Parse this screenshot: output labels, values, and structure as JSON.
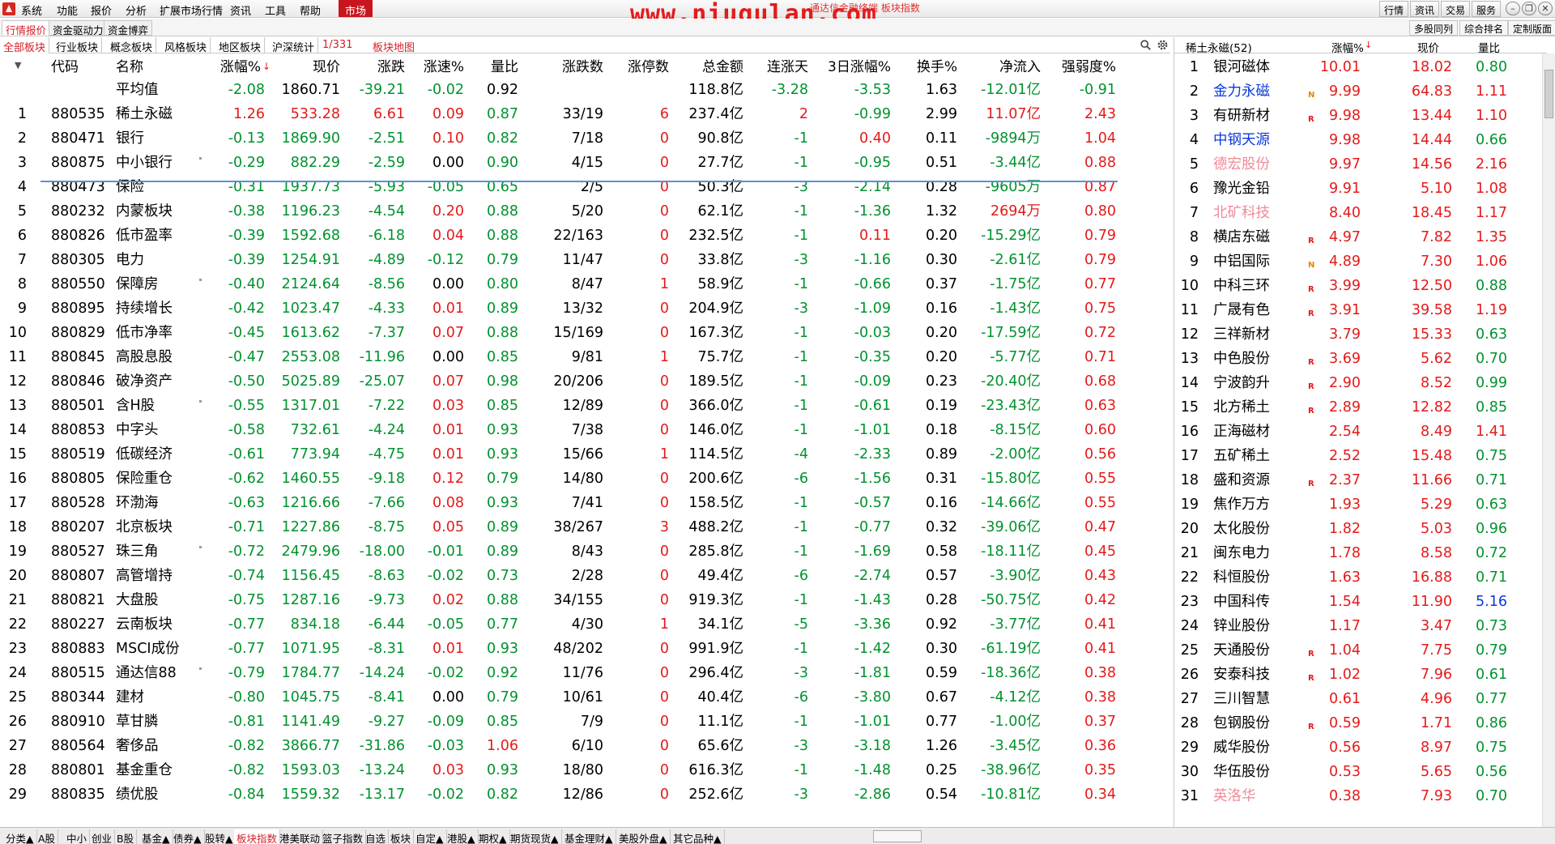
{
  "menu": [
    "系统",
    "功能",
    "报价",
    "分析",
    "扩展市场行情",
    "资讯",
    "工具",
    "帮助"
  ],
  "menu_active": "市场",
  "window_title": "通达信金融终端 板块指数",
  "watermark": "www.niugulan.com",
  "top_buttons": [
    "行情",
    "资讯",
    "交易",
    "服务"
  ],
  "subtabs": [
    "行情报价",
    "资金驱动力",
    "资金博弈"
  ],
  "right_buttons": [
    "多股同列",
    "综合排名",
    "定制版面"
  ],
  "category_tabs": [
    "全部板块",
    "行业板块",
    "概念板块",
    "风格板块",
    "地区板块",
    "沪深统计"
  ],
  "page_counter": "1/331",
  "map_link": "板块地图",
  "columns": [
    "代码",
    "名称",
    "涨幅%",
    "现价",
    "涨跌",
    "涨速%",
    "量比",
    "涨跌数",
    "涨停数",
    "总金额",
    "连涨天",
    "3日涨幅%",
    "换手%",
    "净流入",
    "强弱度%"
  ],
  "average_row": {
    "name": "平均值",
    "chg": "-2.08",
    "price": "1860.71",
    "diff": "-39.21",
    "speed": "-0.02",
    "vr": "0.92",
    "amount": "118.8亿",
    "days": "-3.28",
    "chg3": "-3.53",
    "turnover": "1.63",
    "inflow": "-12.01亿",
    "strength": "-0.91"
  },
  "rows": [
    {
      "n": "1",
      "code": "880535",
      "name": "稀土永磁",
      "chg": "1.26",
      "price": "533.28",
      "diff": "6.61",
      "speed": "0.09",
      "vr": "0.87",
      "updown": "33/19",
      "limit": "6",
      "amount": "237.4亿",
      "days": "2",
      "chg3": "-0.99",
      "turnover": "2.99",
      "inflow": "11.07亿",
      "strength": "2.43",
      "dot": false
    },
    {
      "n": "2",
      "code": "880471",
      "name": "银行",
      "chg": "-0.13",
      "price": "1869.90",
      "diff": "-2.51",
      "speed": "0.10",
      "vr": "0.82",
      "updown": "7/18",
      "limit": "0",
      "amount": "90.8亿",
      "days": "-1",
      "chg3": "0.40",
      "turnover": "0.11",
      "inflow": "-9894万",
      "strength": "1.04",
      "dot": false
    },
    {
      "n": "3",
      "code": "880875",
      "name": "中小银行",
      "chg": "-0.29",
      "price": "882.29",
      "diff": "-2.59",
      "speed": "0.00",
      "vr": "0.90",
      "updown": "4/15",
      "limit": "0",
      "amount": "27.7亿",
      "days": "-1",
      "chg3": "-0.95",
      "turnover": "0.51",
      "inflow": "-3.44亿",
      "strength": "0.88",
      "dot": true
    },
    {
      "n": "4",
      "code": "880473",
      "name": "保险",
      "chg": "-0.31",
      "price": "1937.73",
      "diff": "-5.93",
      "speed": "-0.05",
      "vr": "0.65",
      "updown": "2/5",
      "limit": "0",
      "amount": "50.3亿",
      "days": "-3",
      "chg3": "-2.14",
      "turnover": "0.28",
      "inflow": "-9605万",
      "strength": "0.87",
      "dot": false
    },
    {
      "n": "5",
      "code": "880232",
      "name": "内蒙板块",
      "chg": "-0.38",
      "price": "1196.23",
      "diff": "-4.54",
      "speed": "0.20",
      "vr": "0.88",
      "updown": "5/20",
      "limit": "0",
      "amount": "62.1亿",
      "days": "-1",
      "chg3": "-1.36",
      "turnover": "1.32",
      "inflow": "2694万",
      "strength": "0.80",
      "dot": false
    },
    {
      "n": "6",
      "code": "880826",
      "name": "低市盈率",
      "chg": "-0.39",
      "price": "1592.68",
      "diff": "-6.18",
      "speed": "0.04",
      "vr": "0.88",
      "updown": "22/163",
      "limit": "0",
      "amount": "232.5亿",
      "days": "-1",
      "chg3": "0.11",
      "turnover": "0.20",
      "inflow": "-15.29亿",
      "strength": "0.79",
      "dot": false
    },
    {
      "n": "7",
      "code": "880305",
      "name": "电力",
      "chg": "-0.39",
      "price": "1254.91",
      "diff": "-4.89",
      "speed": "-0.12",
      "vr": "0.79",
      "updown": "11/47",
      "limit": "0",
      "amount": "33.8亿",
      "days": "-3",
      "chg3": "-1.16",
      "turnover": "0.30",
      "inflow": "-2.61亿",
      "strength": "0.79",
      "dot": false
    },
    {
      "n": "8",
      "code": "880550",
      "name": "保障房",
      "chg": "-0.40",
      "price": "2124.64",
      "diff": "-8.56",
      "speed": "0.00",
      "vr": "0.80",
      "updown": "8/47",
      "limit": "1",
      "amount": "58.9亿",
      "days": "-1",
      "chg3": "-0.66",
      "turnover": "0.37",
      "inflow": "-1.75亿",
      "strength": "0.77",
      "dot": true
    },
    {
      "n": "9",
      "code": "880895",
      "name": "持续增长",
      "chg": "-0.42",
      "price": "1023.47",
      "diff": "-4.33",
      "speed": "0.01",
      "vr": "0.89",
      "updown": "13/32",
      "limit": "0",
      "amount": "204.9亿",
      "days": "-3",
      "chg3": "-1.09",
      "turnover": "0.16",
      "inflow": "-1.43亿",
      "strength": "0.75",
      "dot": false
    },
    {
      "n": "10",
      "code": "880829",
      "name": "低市净率",
      "chg": "-0.45",
      "price": "1613.62",
      "diff": "-7.37",
      "speed": "0.07",
      "vr": "0.88",
      "updown": "15/169",
      "limit": "0",
      "amount": "167.3亿",
      "days": "-1",
      "chg3": "-0.03",
      "turnover": "0.20",
      "inflow": "-17.59亿",
      "strength": "0.72",
      "dot": false
    },
    {
      "n": "11",
      "code": "880845",
      "name": "高股息股",
      "chg": "-0.47",
      "price": "2553.08",
      "diff": "-11.96",
      "speed": "0.00",
      "vr": "0.85",
      "updown": "9/81",
      "limit": "1",
      "amount": "75.7亿",
      "days": "-1",
      "chg3": "-0.35",
      "turnover": "0.20",
      "inflow": "-5.77亿",
      "strength": "0.71",
      "dot": false
    },
    {
      "n": "12",
      "code": "880846",
      "name": "破净资产",
      "chg": "-0.50",
      "price": "5025.89",
      "diff": "-25.07",
      "speed": "0.07",
      "vr": "0.98",
      "updown": "20/206",
      "limit": "0",
      "amount": "189.5亿",
      "days": "-1",
      "chg3": "-0.09",
      "turnover": "0.23",
      "inflow": "-20.40亿",
      "strength": "0.68",
      "dot": false
    },
    {
      "n": "13",
      "code": "880501",
      "name": "含H股",
      "chg": "-0.55",
      "price": "1317.01",
      "diff": "-7.22",
      "speed": "0.03",
      "vr": "0.85",
      "updown": "12/89",
      "limit": "0",
      "amount": "366.0亿",
      "days": "-1",
      "chg3": "-0.61",
      "turnover": "0.19",
      "inflow": "-23.43亿",
      "strength": "0.63",
      "dot": true
    },
    {
      "n": "14",
      "code": "880853",
      "name": "中字头",
      "chg": "-0.58",
      "price": "732.61",
      "diff": "-4.24",
      "speed": "0.01",
      "vr": "0.93",
      "updown": "7/38",
      "limit": "0",
      "amount": "146.0亿",
      "days": "-1",
      "chg3": "-1.01",
      "turnover": "0.18",
      "inflow": "-8.15亿",
      "strength": "0.60",
      "dot": false
    },
    {
      "n": "15",
      "code": "880519",
      "name": "低碳经济",
      "chg": "-0.61",
      "price": "773.94",
      "diff": "-4.75",
      "speed": "0.01",
      "vr": "0.93",
      "updown": "15/66",
      "limit": "1",
      "amount": "114.5亿",
      "days": "-4",
      "chg3": "-2.33",
      "turnover": "0.89",
      "inflow": "-2.00亿",
      "strength": "0.56",
      "dot": false
    },
    {
      "n": "16",
      "code": "880805",
      "name": "保险重仓",
      "chg": "-0.62",
      "price": "1460.55",
      "diff": "-9.18",
      "speed": "0.12",
      "vr": "0.79",
      "updown": "14/80",
      "limit": "0",
      "amount": "200.6亿",
      "days": "-6",
      "chg3": "-1.56",
      "turnover": "0.31",
      "inflow": "-15.80亿",
      "strength": "0.55",
      "dot": false
    },
    {
      "n": "17",
      "code": "880528",
      "name": "环渤海",
      "chg": "-0.63",
      "price": "1216.66",
      "diff": "-7.66",
      "speed": "0.08",
      "vr": "0.93",
      "updown": "7/41",
      "limit": "0",
      "amount": "158.5亿",
      "days": "-1",
      "chg3": "-0.57",
      "turnover": "0.16",
      "inflow": "-14.66亿",
      "strength": "0.55",
      "dot": false
    },
    {
      "n": "18",
      "code": "880207",
      "name": "北京板块",
      "chg": "-0.71",
      "price": "1227.86",
      "diff": "-8.75",
      "speed": "0.05",
      "vr": "0.89",
      "updown": "38/267",
      "limit": "3",
      "amount": "488.2亿",
      "days": "-1",
      "chg3": "-0.77",
      "turnover": "0.32",
      "inflow": "-39.06亿",
      "strength": "0.47",
      "dot": false
    },
    {
      "n": "19",
      "code": "880527",
      "name": "珠三角",
      "chg": "-0.72",
      "price": "2479.96",
      "diff": "-18.00",
      "speed": "-0.01",
      "vr": "0.89",
      "updown": "8/43",
      "limit": "0",
      "amount": "285.8亿",
      "days": "-1",
      "chg3": "-1.69",
      "turnover": "0.58",
      "inflow": "-18.11亿",
      "strength": "0.45",
      "dot": true
    },
    {
      "n": "20",
      "code": "880807",
      "name": "高管增持",
      "chg": "-0.74",
      "price": "1156.45",
      "diff": "-8.63",
      "speed": "-0.02",
      "vr": "0.73",
      "updown": "2/28",
      "limit": "0",
      "amount": "49.4亿",
      "days": "-6",
      "chg3": "-2.74",
      "turnover": "0.57",
      "inflow": "-3.90亿",
      "strength": "0.43",
      "dot": false
    },
    {
      "n": "21",
      "code": "880821",
      "name": "大盘股",
      "chg": "-0.75",
      "price": "1287.16",
      "diff": "-9.73",
      "speed": "0.02",
      "vr": "0.88",
      "updown": "34/155",
      "limit": "0",
      "amount": "919.3亿",
      "days": "-1",
      "chg3": "-1.43",
      "turnover": "0.28",
      "inflow": "-50.75亿",
      "strength": "0.42",
      "dot": false
    },
    {
      "n": "22",
      "code": "880227",
      "name": "云南板块",
      "chg": "-0.77",
      "price": "834.18",
      "diff": "-6.44",
      "speed": "-0.05",
      "vr": "0.77",
      "updown": "4/30",
      "limit": "1",
      "amount": "34.1亿",
      "days": "-5",
      "chg3": "-3.36",
      "turnover": "0.92",
      "inflow": "-3.77亿",
      "strength": "0.41",
      "dot": false
    },
    {
      "n": "23",
      "code": "880883",
      "name": "MSCI成份",
      "chg": "-0.77",
      "price": "1071.95",
      "diff": "-8.31",
      "speed": "0.01",
      "vr": "0.93",
      "updown": "48/202",
      "limit": "0",
      "amount": "991.9亿",
      "days": "-1",
      "chg3": "-1.42",
      "turnover": "0.30",
      "inflow": "-61.19亿",
      "strength": "0.41",
      "dot": false
    },
    {
      "n": "24",
      "code": "880515",
      "name": "通达信88",
      "chg": "-0.79",
      "price": "1784.77",
      "diff": "-14.24",
      "speed": "-0.02",
      "vr": "0.92",
      "updown": "11/76",
      "limit": "0",
      "amount": "296.4亿",
      "days": "-3",
      "chg3": "-1.81",
      "turnover": "0.59",
      "inflow": "-18.36亿",
      "strength": "0.38",
      "dot": true
    },
    {
      "n": "25",
      "code": "880344",
      "name": "建材",
      "chg": "-0.80",
      "price": "1045.75",
      "diff": "-8.41",
      "speed": "0.00",
      "vr": "0.79",
      "updown": "10/61",
      "limit": "0",
      "amount": "40.4亿",
      "days": "-6",
      "chg3": "-3.80",
      "turnover": "0.67",
      "inflow": "-4.12亿",
      "strength": "0.38",
      "dot": false
    },
    {
      "n": "26",
      "code": "880910",
      "name": "草甘膦",
      "chg": "-0.81",
      "price": "1141.49",
      "diff": "-9.27",
      "speed": "-0.09",
      "vr": "0.85",
      "updown": "7/9",
      "limit": "0",
      "amount": "11.1亿",
      "days": "-1",
      "chg3": "-1.01",
      "turnover": "0.77",
      "inflow": "-1.00亿",
      "strength": "0.37",
      "dot": false
    },
    {
      "n": "27",
      "code": "880564",
      "name": "奢侈品",
      "chg": "-0.82",
      "price": "3866.77",
      "diff": "-31.86",
      "speed": "-0.03",
      "vr": "1.06",
      "updown": "6/10",
      "limit": "0",
      "amount": "65.6亿",
      "days": "-3",
      "chg3": "-3.18",
      "turnover": "1.26",
      "inflow": "-3.45亿",
      "strength": "0.36",
      "dot": false
    },
    {
      "n": "28",
      "code": "880801",
      "name": "基金重仓",
      "chg": "-0.82",
      "price": "1593.03",
      "diff": "-13.24",
      "speed": "0.03",
      "vr": "0.93",
      "updown": "18/80",
      "limit": "0",
      "amount": "616.3亿",
      "days": "-1",
      "chg3": "-1.48",
      "turnover": "0.25",
      "inflow": "-38.96亿",
      "strength": "0.35",
      "dot": false
    },
    {
      "n": "29",
      "code": "880835",
      "name": "绩优股",
      "chg": "-0.84",
      "price": "1559.32",
      "diff": "-13.17",
      "speed": "-0.02",
      "vr": "0.82",
      "updown": "12/86",
      "limit": "0",
      "amount": "252.6亿",
      "days": "-3",
      "chg3": "-2.86",
      "turnover": "0.54",
      "inflow": "-10.81亿",
      "strength": "0.34",
      "dot": false
    }
  ],
  "right_panel": {
    "title": "稀土永磁(52)",
    "columns": [
      "涨幅%",
      "现价",
      "量比"
    ],
    "rows": [
      {
        "n": "1",
        "name": "银河磁体",
        "style": "black",
        "flag": "",
        "chg": "10.01",
        "price": "18.02",
        "vr": "0.80",
        "vr_style": "green"
      },
      {
        "n": "2",
        "name": "金力永磁",
        "style": "blue",
        "flag": "N",
        "chg": "9.99",
        "price": "64.83",
        "vr": "1.11",
        "vr_style": "red"
      },
      {
        "n": "3",
        "name": "有研新材",
        "style": "black",
        "flag": "R",
        "chg": "9.98",
        "price": "13.44",
        "vr": "1.10",
        "vr_style": "red"
      },
      {
        "n": "4",
        "name": "中钢天源",
        "style": "blue",
        "flag": "",
        "chg": "9.98",
        "price": "14.44",
        "vr": "0.66",
        "vr_style": "green"
      },
      {
        "n": "5",
        "name": "德宏股份",
        "style": "pink",
        "flag": "",
        "chg": "9.97",
        "price": "14.56",
        "vr": "2.16",
        "vr_style": "red"
      },
      {
        "n": "6",
        "name": "豫光金铅",
        "style": "black",
        "flag": "",
        "chg": "9.91",
        "price": "5.10",
        "vr": "1.08",
        "vr_style": "red"
      },
      {
        "n": "7",
        "name": "北矿科技",
        "style": "pink",
        "flag": "",
        "chg": "8.40",
        "price": "18.45",
        "vr": "1.17",
        "vr_style": "red"
      },
      {
        "n": "8",
        "name": "横店东磁",
        "style": "black",
        "flag": "R",
        "chg": "4.97",
        "price": "7.82",
        "vr": "1.35",
        "vr_style": "red"
      },
      {
        "n": "9",
        "name": "中铝国际",
        "style": "black",
        "flag": "N",
        "chg": "4.89",
        "price": "7.30",
        "vr": "1.06",
        "vr_style": "red"
      },
      {
        "n": "10",
        "name": "中科三环",
        "style": "black",
        "flag": "R",
        "chg": "3.99",
        "price": "12.50",
        "vr": "0.88",
        "vr_style": "green"
      },
      {
        "n": "11",
        "name": "广晟有色",
        "style": "black",
        "flag": "R",
        "chg": "3.91",
        "price": "39.58",
        "vr": "1.19",
        "vr_style": "red"
      },
      {
        "n": "12",
        "name": "三祥新材",
        "style": "black",
        "flag": "",
        "chg": "3.79",
        "price": "15.33",
        "vr": "0.63",
        "vr_style": "green"
      },
      {
        "n": "13",
        "name": "中色股份",
        "style": "black",
        "flag": "R",
        "chg": "3.69",
        "price": "5.62",
        "vr": "0.70",
        "vr_style": "green"
      },
      {
        "n": "14",
        "name": "宁波韵升",
        "style": "black",
        "flag": "R",
        "chg": "2.90",
        "price": "8.52",
        "vr": "0.99",
        "vr_style": "green"
      },
      {
        "n": "15",
        "name": "北方稀土",
        "style": "black",
        "flag": "R",
        "chg": "2.89",
        "price": "12.82",
        "vr": "0.85",
        "vr_style": "green"
      },
      {
        "n": "16",
        "name": "正海磁材",
        "style": "black",
        "flag": "",
        "chg": "2.54",
        "price": "8.49",
        "vr": "1.41",
        "vr_style": "red"
      },
      {
        "n": "17",
        "name": "五矿稀土",
        "style": "black",
        "flag": "",
        "chg": "2.52",
        "price": "15.48",
        "vr": "0.75",
        "vr_style": "green"
      },
      {
        "n": "18",
        "name": "盛和资源",
        "style": "black",
        "flag": "R",
        "chg": "2.37",
        "price": "11.66",
        "vr": "0.71",
        "vr_style": "green"
      },
      {
        "n": "19",
        "name": "焦作万方",
        "style": "black",
        "flag": "",
        "chg": "1.93",
        "price": "5.29",
        "vr": "0.63",
        "vr_style": "green"
      },
      {
        "n": "20",
        "name": "太化股份",
        "style": "black",
        "flag": "",
        "chg": "1.82",
        "price": "5.03",
        "vr": "0.96",
        "vr_style": "green"
      },
      {
        "n": "21",
        "name": "闽东电力",
        "style": "black",
        "flag": "",
        "chg": "1.78",
        "price": "8.58",
        "vr": "0.72",
        "vr_style": "green"
      },
      {
        "n": "22",
        "name": "科恒股份",
        "style": "black",
        "flag": "",
        "chg": "1.63",
        "price": "16.88",
        "vr": "0.71",
        "vr_style": "green"
      },
      {
        "n": "23",
        "name": "中国科传",
        "style": "black",
        "flag": "",
        "chg": "1.54",
        "price": "11.90",
        "vr": "5.16",
        "vr_style": "blue"
      },
      {
        "n": "24",
        "name": "锌业股份",
        "style": "black",
        "flag": "",
        "chg": "1.17",
        "price": "3.47",
        "vr": "0.73",
        "vr_style": "green"
      },
      {
        "n": "25",
        "name": "天通股份",
        "style": "black",
        "flag": "R",
        "chg": "1.04",
        "price": "7.75",
        "vr": "0.79",
        "vr_style": "green"
      },
      {
        "n": "26",
        "name": "安泰科技",
        "style": "black",
        "flag": "R",
        "chg": "1.02",
        "price": "7.96",
        "vr": "0.61",
        "vr_style": "green"
      },
      {
        "n": "27",
        "name": "三川智慧",
        "style": "black",
        "flag": "",
        "chg": "0.61",
        "price": "4.96",
        "vr": "0.77",
        "vr_style": "green"
      },
      {
        "n": "28",
        "name": "包钢股份",
        "style": "black",
        "flag": "R",
        "chg": "0.59",
        "price": "1.71",
        "vr": "0.86",
        "vr_style": "green"
      },
      {
        "n": "29",
        "name": "威华股份",
        "style": "black",
        "flag": "",
        "chg": "0.56",
        "price": "8.97",
        "vr": "0.75",
        "vr_style": "green"
      },
      {
        "n": "30",
        "name": "华伍股份",
        "style": "black",
        "flag": "",
        "chg": "0.53",
        "price": "5.65",
        "vr": "0.56",
        "vr_style": "green"
      },
      {
        "n": "31",
        "name": "英洛华",
        "style": "pink",
        "flag": "",
        "chg": "0.38",
        "price": "7.93",
        "vr": "0.70",
        "vr_style": "green"
      }
    ]
  },
  "bottom_tabs": [
    "分类▲",
    "A股",
    "中小",
    "创业",
    "B股",
    "基金▲",
    "债券▲",
    "股转▲",
    "板块指数",
    "港美联动",
    "篮子指数",
    "自选",
    "板块",
    "自定▲",
    "港股▲",
    "期权▲",
    "期货现货▲",
    "基金理财▲",
    "美股外盘▲",
    "其它品种▲"
  ],
  "bottom_active": "板块指数",
  "colors": {
    "up": "#e41a1a",
    "down": "#00922f",
    "accent": "#c8161d",
    "blue_name": "#0a39e0",
    "pink_name": "#f08a9a",
    "selection_line": "#5b8fd6"
  }
}
